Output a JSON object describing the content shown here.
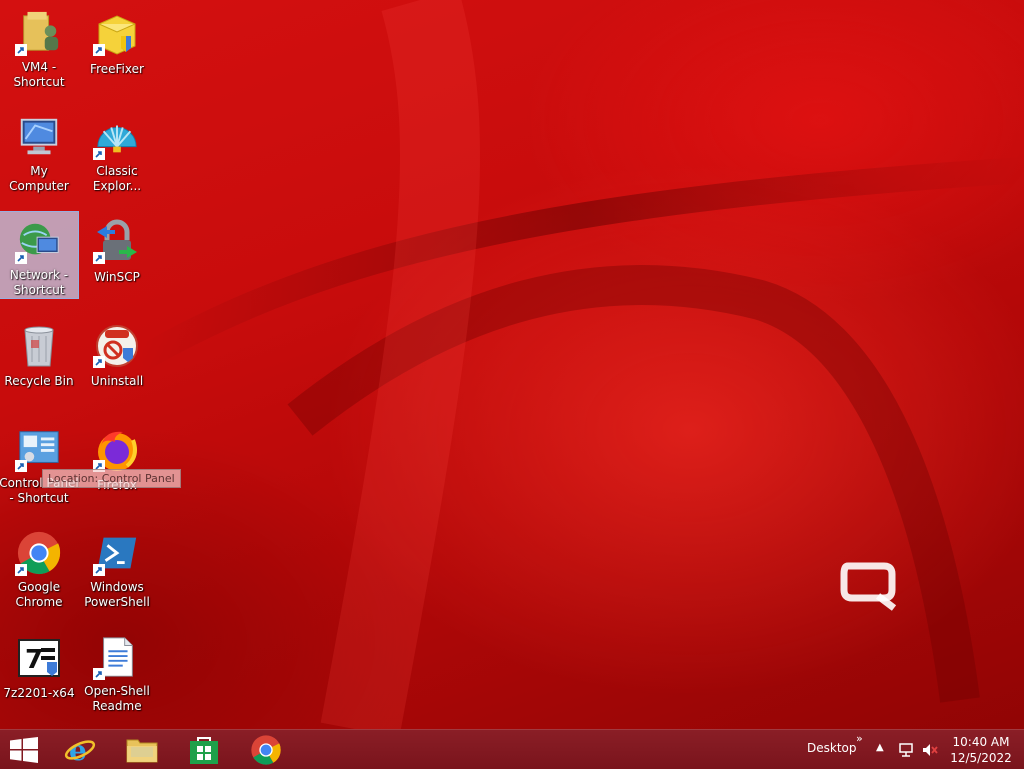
{
  "desktop": {
    "icons": [
      {
        "label": "VM4 - Shortcut",
        "icon": "folder-user-icon"
      },
      {
        "label": "FreeFixer",
        "icon": "freefixer-icon"
      },
      {
        "label": "My Computer",
        "icon": "computer-icon"
      },
      {
        "label": "Classic Explor...",
        "icon": "shell-icon"
      },
      {
        "label": "Network - Shortcut",
        "icon": "network-icon"
      },
      {
        "label": "WinSCP",
        "icon": "winscp-icon"
      },
      {
        "label": "Recycle Bin",
        "icon": "recycle-bin-icon"
      },
      {
        "label": "Uninstall",
        "icon": "uninstall-icon"
      },
      {
        "label": "Control Panel - Shortcut",
        "icon": "control-panel-icon"
      },
      {
        "label": "Firefox",
        "icon": "firefox-icon"
      },
      {
        "label": "Google Chrome",
        "icon": "chrome-icon"
      },
      {
        "label": "Windows PowerShell",
        "icon": "powershell-icon"
      },
      {
        "label": "7z2201-x64",
        "icon": "7zip-icon"
      },
      {
        "label": "Open-Shell Readme",
        "icon": "document-icon"
      }
    ],
    "selected_icon": "Network - Shortcut",
    "tooltip": "Location: Control Panel"
  },
  "taskbar": {
    "buttons": [
      {
        "name": "start-button",
        "icon": "windows-logo-icon"
      },
      {
        "name": "internet-explorer",
        "icon": "ie-icon"
      },
      {
        "name": "file-explorer",
        "icon": "folder-icon"
      },
      {
        "name": "store",
        "icon": "store-icon"
      },
      {
        "name": "google-chrome",
        "icon": "chrome-icon"
      }
    ],
    "toolbar_label": "Desktop",
    "chevron": "»",
    "tray_arrow": "▲",
    "clock": {
      "time": "10:40 AM",
      "date": "12/5/2022"
    }
  },
  "colors": {
    "taskbar": "#7a141c",
    "wallpaper": "#c80c0c"
  }
}
